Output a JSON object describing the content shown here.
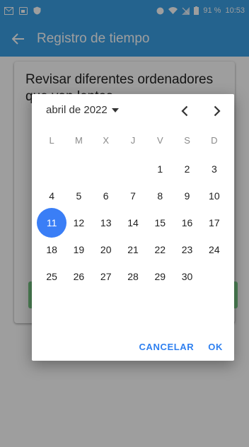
{
  "status_bar": {
    "battery_percent": "91 %",
    "time": "10:53"
  },
  "app_bar": {
    "title": "Registro de tiempo"
  },
  "task": {
    "title": "Revisar diferentes ordenadores que van lentos"
  },
  "date_picker": {
    "month_year": "abril de 2022",
    "weekdays": [
      "L",
      "M",
      "X",
      "J",
      "V",
      "S",
      "D"
    ],
    "leading_blanks": 4,
    "days": [
      "1",
      "2",
      "3",
      "4",
      "5",
      "6",
      "7",
      "8",
      "9",
      "10",
      "11",
      "12",
      "13",
      "14",
      "15",
      "16",
      "17",
      "18",
      "19",
      "20",
      "21",
      "22",
      "23",
      "24",
      "25",
      "26",
      "27",
      "28",
      "29",
      "30"
    ],
    "selected_day": "11",
    "cancel_label": "CANCELAR",
    "ok_label": "OK"
  },
  "colors": {
    "accent": "#3ba0e6",
    "selected": "#3a7ef6",
    "action": "#2f80f0",
    "confirm_bar": "#7bd08a"
  }
}
